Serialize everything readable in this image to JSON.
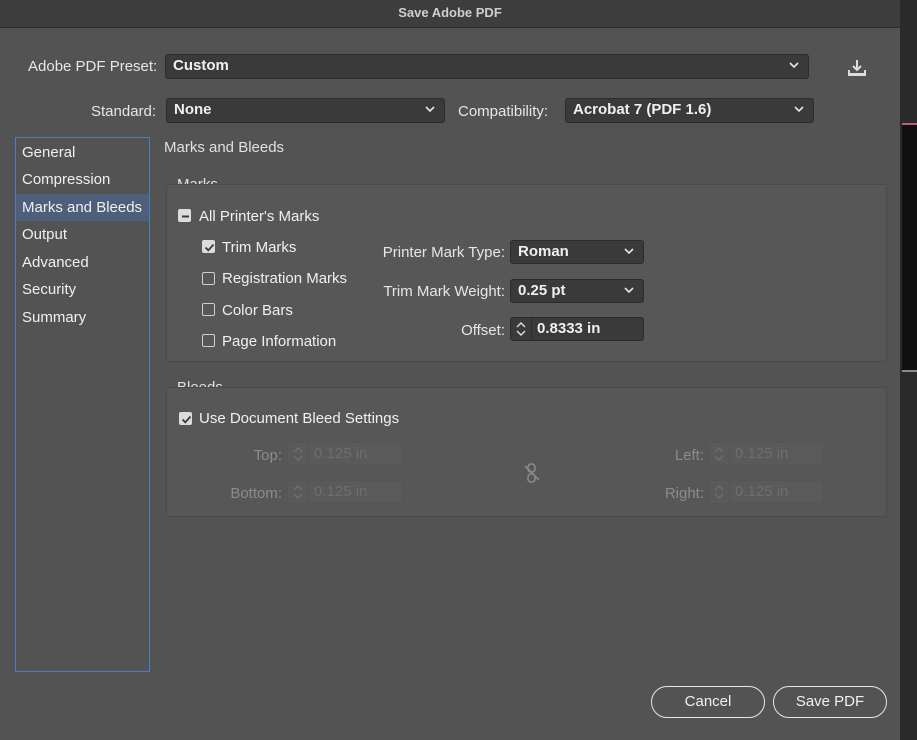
{
  "window": {
    "title": "Save Adobe PDF"
  },
  "preset": {
    "label": "Adobe PDF Preset:",
    "value": "Custom"
  },
  "standard": {
    "label": "Standard:",
    "value": "None"
  },
  "compatibility": {
    "label": "Compatibility:",
    "value": "Acrobat 7 (PDF 1.6)"
  },
  "sidebar": {
    "items": [
      {
        "label": "General"
      },
      {
        "label": "Compression"
      },
      {
        "label": "Marks and Bleeds",
        "active": true
      },
      {
        "label": "Output"
      },
      {
        "label": "Advanced"
      },
      {
        "label": "Security"
      },
      {
        "label": "Summary"
      }
    ]
  },
  "panel": {
    "title": "Marks and Bleeds",
    "marks": {
      "title": "Marks",
      "all_printers_marks": {
        "label": "All Printer's Marks",
        "state": "mixed"
      },
      "trim_marks": {
        "label": "Trim Marks",
        "checked": true
      },
      "registration_marks": {
        "label": "Registration Marks",
        "checked": false
      },
      "color_bars": {
        "label": "Color Bars",
        "checked": false
      },
      "page_information": {
        "label": "Page Information",
        "checked": false
      },
      "printer_mark_type": {
        "label": "Printer Mark Type:",
        "value": "Roman"
      },
      "trim_mark_weight": {
        "label": "Trim Mark Weight:",
        "value": "0.25 pt"
      },
      "offset": {
        "label": "Offset:",
        "value": "0.8333 in"
      }
    },
    "bleeds": {
      "title": "Bleeds",
      "use_document_bleed": {
        "label": "Use Document Bleed Settings",
        "checked": true
      },
      "top": {
        "label": "Top:",
        "value": "0.125 in"
      },
      "bottom": {
        "label": "Bottom:",
        "value": "0.125 in"
      },
      "left": {
        "label": "Left:",
        "value": "0.125 in"
      },
      "right": {
        "label": "Right:",
        "value": "0.125 in"
      }
    }
  },
  "buttons": {
    "cancel": "Cancel",
    "save": "Save PDF"
  }
}
